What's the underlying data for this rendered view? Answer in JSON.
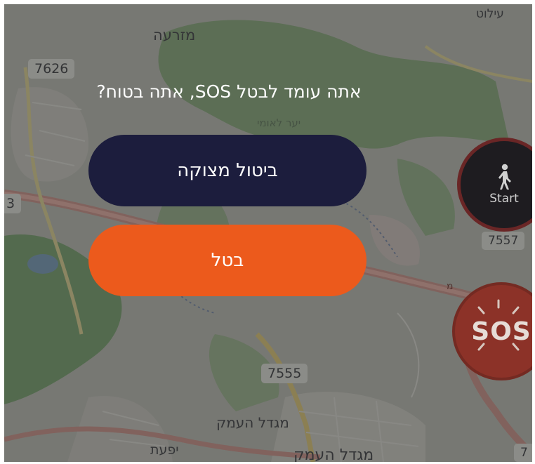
{
  "dialog": {
    "title": "אתה עומד לבטל SOS, אתה בטוח?",
    "confirm_label": "ביטול מצוקה",
    "cancel_label": "בטל"
  },
  "fabs": {
    "start_label": "Start",
    "start_icon": "walking-person-icon",
    "sos_label": "SOS",
    "sos_icon": "sos-alarm-icon"
  },
  "map": {
    "labels": {
      "top_right": "עילוט",
      "top_center": "מזרעה",
      "forest": "יער לאומי",
      "bottom_center": "מגדל העמק",
      "bottom_center_2": "מגדל העמק",
      "bottom_left": "יפעת",
      "road_label_mid": "מ"
    },
    "roads": {
      "road_7626": "7626",
      "road_7555": "7555",
      "road_7557": "7557",
      "road_edge_left": "3",
      "road_edge_bottom_right": "7"
    }
  },
  "colors": {
    "confirm_button": "#1c1d3d",
    "cancel_button": "#ec5a1c",
    "start_fab": "#1e1c20",
    "sos_fab": "#8c3228"
  }
}
